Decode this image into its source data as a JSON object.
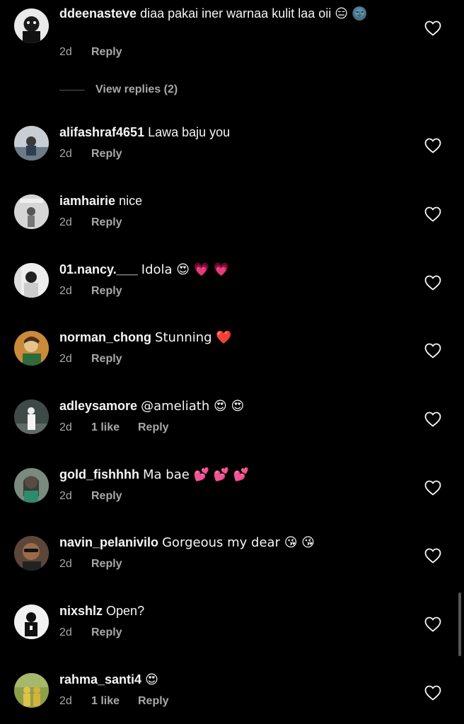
{
  "comments": [
    {
      "username": "ddeenasteve",
      "text": "diaa pakai iner warnaa kulit laa oii 😑 🌚",
      "time": "2d",
      "likes": "",
      "reply": "Reply",
      "avatar_color": "#2b2b2b"
    },
    {
      "username": "alifashraf4651",
      "text": "Lawa baju you",
      "time": "2d",
      "likes": "",
      "reply": "Reply",
      "avatar_color": "#6b7a86"
    },
    {
      "username": "iamhairie",
      "text": "nice",
      "time": "2d",
      "likes": "",
      "reply": "Reply",
      "avatar_color": "#cfcfcf"
    },
    {
      "username": "01.nancy.___",
      "text": "Idola 😍 💗 💗",
      "time": "2d",
      "likes": "",
      "reply": "Reply",
      "avatar_color": "#e8e4dc"
    },
    {
      "username": "norman_chong",
      "text": "Stunning ❤️",
      "time": "2d",
      "likes": "",
      "reply": "Reply",
      "avatar_color": "#c98a3a"
    },
    {
      "username": "adleysamore",
      "text": "@ameliath 😍 😍",
      "time": "2d",
      "likes": "1 like",
      "reply": "Reply",
      "avatar_color": "#3e4a47"
    },
    {
      "username": "gold_fishhhh",
      "text": "Ma bae 💕 💕 💕",
      "time": "2d",
      "likes": "",
      "reply": "Reply",
      "avatar_color": "#7a8a7e"
    },
    {
      "username": "navin_pelanivilo",
      "text": "Gorgeous my dear 😘 😘",
      "time": "2d",
      "likes": "",
      "reply": "Reply",
      "avatar_color": "#5d4638"
    },
    {
      "username": "nixshlz",
      "text": "Open?",
      "time": "2d",
      "likes": "",
      "reply": "Reply",
      "avatar_color": "#f2f2f2"
    },
    {
      "username": "rahma_santi4",
      "text": "😍",
      "time": "2d",
      "likes": "1 like",
      "reply": "Reply",
      "avatar_color": "#8ca04a"
    }
  ],
  "view_replies": "View replies (2)",
  "colors": {
    "background": "#000000",
    "primary_text": "#f5f5f5",
    "secondary_text": "#a8a8a8"
  },
  "icons": {
    "like": "heart-outline-icon"
  }
}
